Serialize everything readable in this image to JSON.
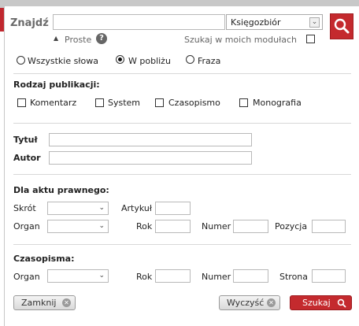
{
  "header": {
    "find_label": "Znajdź",
    "search_value": "",
    "collection_select": "Księgozbiór"
  },
  "subbar": {
    "simple_link": "Proste",
    "help_icon": "question-icon",
    "my_modules_label": "Szukaj w moich modułach",
    "my_modules_checked": false
  },
  "match_mode": {
    "options": [
      "Wszystkie słowa",
      "W pobliżu",
      "Fraza"
    ],
    "selected": "W pobliżu"
  },
  "publication_type": {
    "heading": "Rodzaj publikacji:",
    "options": [
      "Komentarz",
      "System",
      "Czasopismo",
      "Monografia"
    ]
  },
  "title_author": {
    "title_label": "Tytuł",
    "author_label": "Autor"
  },
  "legal_act": {
    "heading": "Dla aktu prawnego:",
    "shortcut_label": "Skrót",
    "article_label": "Artykuł",
    "organ_label": "Organ",
    "year_label": "Rok",
    "number_label": "Numer",
    "position_label": "Pozycja"
  },
  "journal": {
    "heading": "Czasopisma:",
    "organ_label": "Organ",
    "year_label": "Rok",
    "number_label": "Numer",
    "page_label": "Strona"
  },
  "footer": {
    "close_label": "Zamknij",
    "clear_label": "Wyczyść",
    "search_label": "Szukaj"
  },
  "colors": {
    "accent": "#c42a2e"
  }
}
